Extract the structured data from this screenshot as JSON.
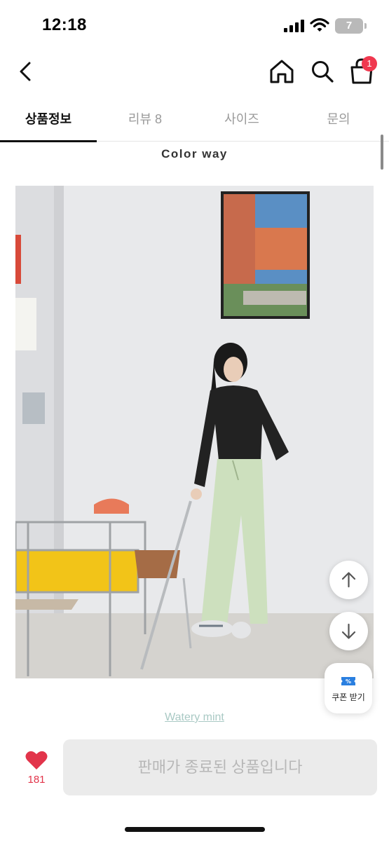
{
  "status_bar": {
    "time": "12:18",
    "battery_level": "7"
  },
  "nav": {
    "cart_count": "1"
  },
  "tabs": [
    {
      "label": "상품정보",
      "active": true
    },
    {
      "label": "리뷰 8",
      "active": false
    },
    {
      "label": "사이즈",
      "active": false
    },
    {
      "label": "문의",
      "active": false
    }
  ],
  "content": {
    "section_title": "Color way",
    "caption": "Watery mint"
  },
  "coupon": {
    "label": "쿠폰 받기"
  },
  "bottom_bar": {
    "like_count": "181",
    "status_button_label": "판매가 종료된 상품입니다"
  },
  "colors": {
    "accent": "#f0384f",
    "like": "#e2344a",
    "caption": "#a9c9c4",
    "disabled_bg": "#ebebeb"
  }
}
